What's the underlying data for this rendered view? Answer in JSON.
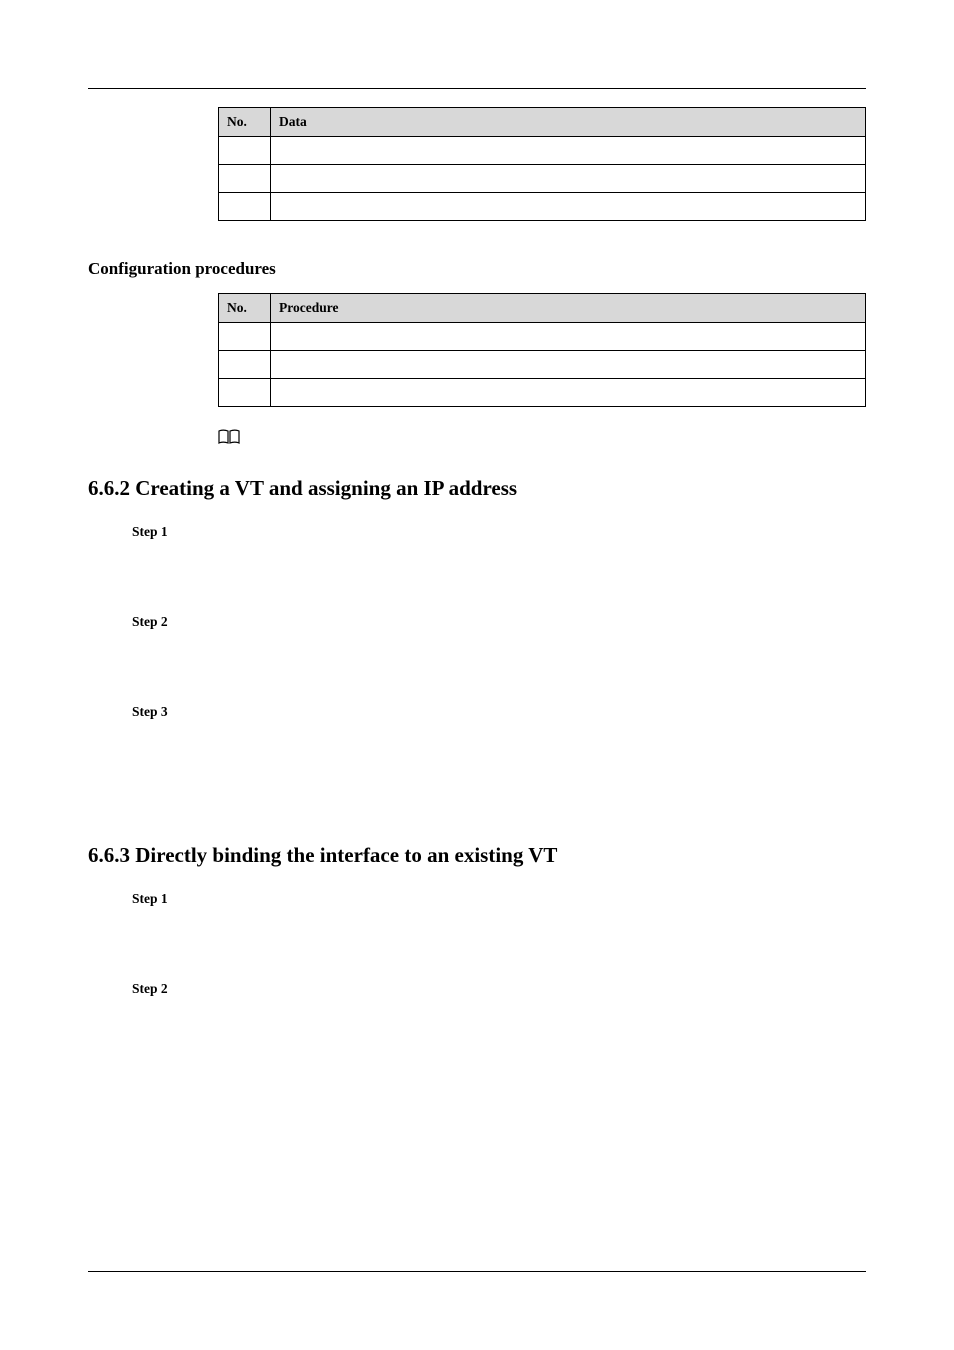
{
  "table1": {
    "headers": {
      "no": "No.",
      "data": "Data"
    },
    "rows": [
      {
        "no": "",
        "data": ""
      },
      {
        "no": "",
        "data": ""
      },
      {
        "no": "",
        "data": ""
      }
    ]
  },
  "config_heading": "Configuration procedures",
  "table2": {
    "headers": {
      "no": "No.",
      "proc": "Procedure"
    },
    "rows": [
      {
        "no": "",
        "proc": ""
      },
      {
        "no": "",
        "proc": ""
      },
      {
        "no": "",
        "proc": ""
      }
    ]
  },
  "section_662": "6.6.2 Creating a VT and assigning an IP address",
  "steps_662": {
    "s1": "Step 1",
    "s2": "Step 2",
    "s3": "Step 3"
  },
  "section_663": "6.6.3 Directly binding the interface to an existing VT",
  "steps_663": {
    "s1": "Step 1",
    "s2": "Step 2"
  }
}
